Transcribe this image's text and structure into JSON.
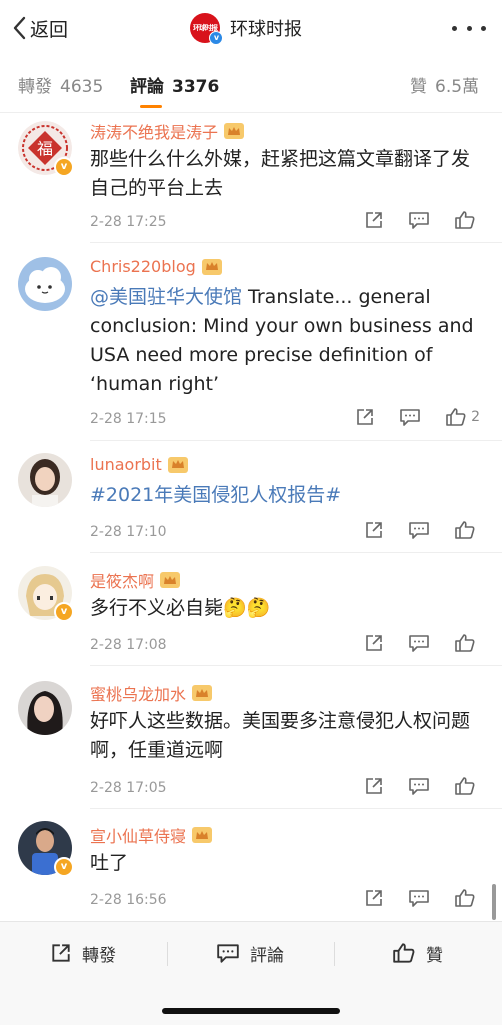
{
  "header": {
    "back_label": "返回",
    "logo_text": "环球时报",
    "title": "环球时报"
  },
  "tabs": [
    {
      "label": "轉發",
      "count": "4635",
      "active": false
    },
    {
      "label": "評論",
      "count": "3376",
      "active": true
    },
    {
      "label": "贊",
      "count": "6.5萬",
      "active": false
    }
  ],
  "colors": {
    "accent": "#ff8200",
    "username": "#eb7350",
    "link": "#4a7ab8",
    "logo_red": "#d8121b",
    "verified_badge": "#f5a623"
  },
  "comments": [
    {
      "username": "涛涛不绝我是涛子",
      "text": "那些什么什么外媒，赶紧把这篇文章翻译了发自己的平台上去",
      "time": "2-28 17:25",
      "likes": "",
      "verified": true,
      "avatar_icon": "fu-character-avatar"
    },
    {
      "username": "Chris220blog",
      "mention": "@美国驻华大使馆",
      "text": " Translate... general conclusion: Mind your own business and USA need more precise definition of ‘human right’",
      "time": "2-28 17:15",
      "likes": "2",
      "verified": false,
      "avatar_icon": "cloud-cat-avatar"
    },
    {
      "username": "lunaorbit",
      "hashtag": "#2021年美国侵犯人权报告#",
      "time": "2-28 17:10",
      "likes": "",
      "verified": false,
      "avatar_icon": "girl-portrait-avatar"
    },
    {
      "username": "是筱杰啊",
      "text": "多行不义必自毙",
      "emojis": "🤔🤔",
      "time": "2-28 17:08",
      "likes": "",
      "verified": true,
      "avatar_icon": "anime-girl-avatar"
    },
    {
      "username": "蜜桃乌龙加水",
      "text": "好吓人这些数据。美国要多注意侵犯人权问题啊，任重道远啊",
      "time": "2-28 17:05",
      "likes": "",
      "verified": false,
      "avatar_icon": "woman-portrait-avatar"
    },
    {
      "username": "宣小仙草侍寝",
      "text": "吐了",
      "time": "2-28 16:56",
      "likes": "",
      "verified": true,
      "avatar_icon": "basketball-player-avatar"
    }
  ],
  "bottom_bar": {
    "repost_label": "轉發",
    "comment_label": "評論",
    "like_label": "贊"
  }
}
